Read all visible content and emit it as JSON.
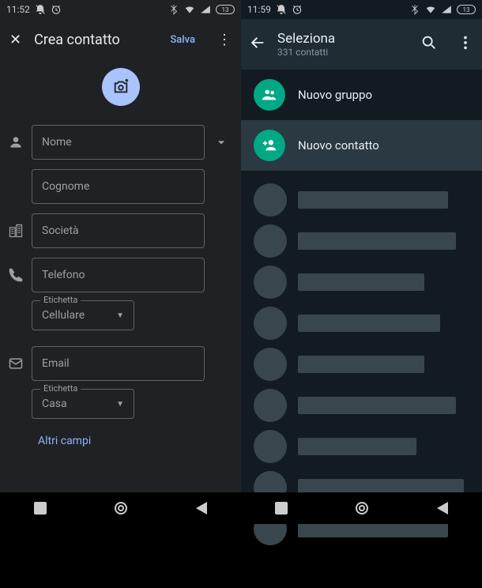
{
  "left": {
    "status_time": "11:52",
    "status_battery": "13",
    "title": "Crea contatto",
    "save": "Salva",
    "fields": {
      "name_ph": "Nome",
      "surname_ph": "Cognome",
      "company_ph": "Società",
      "phone_ph": "Telefono",
      "phone_label_title": "Etichetta",
      "phone_label_value": "Cellulare",
      "email_ph": "Email",
      "email_label_title": "Etichetta",
      "email_label_value": "Casa"
    },
    "more_fields": "Altri campi"
  },
  "right": {
    "status_time": "11:59",
    "status_battery": "13",
    "title": "Seleziona",
    "subtitle": "331 contatti",
    "new_group": "Nuovo gruppo",
    "new_contact": "Nuovo contatto"
  }
}
